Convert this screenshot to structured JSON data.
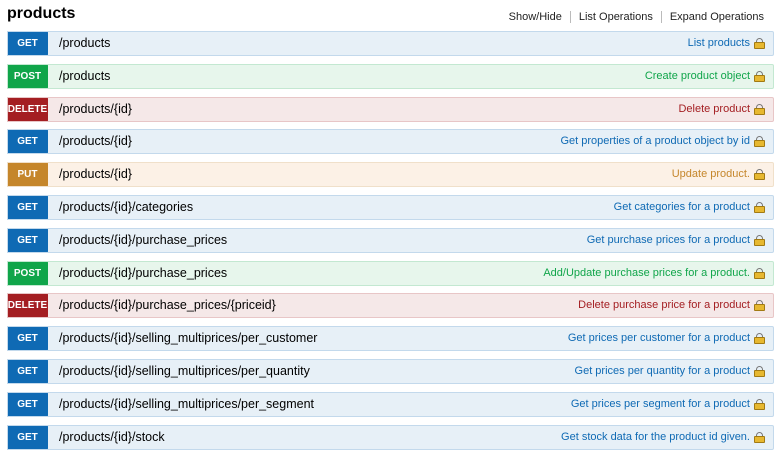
{
  "section": {
    "title": "products",
    "links": [
      "Show/Hide",
      "List Operations",
      "Expand Operations"
    ]
  },
  "operations": [
    {
      "method": "GET",
      "path": "/products",
      "summary": "List products"
    },
    {
      "method": "POST",
      "path": "/products",
      "summary": "Create product object"
    },
    {
      "method": "DELETE",
      "path": "/products/{id}",
      "summary": "Delete product"
    },
    {
      "method": "GET",
      "path": "/products/{id}",
      "summary": "Get properties of a product object by id"
    },
    {
      "method": "PUT",
      "path": "/products/{id}",
      "summary": "Update product."
    },
    {
      "method": "GET",
      "path": "/products/{id}/categories",
      "summary": "Get categories for a product"
    },
    {
      "method": "GET",
      "path": "/products/{id}/purchase_prices",
      "summary": "Get purchase prices for a product"
    },
    {
      "method": "POST",
      "path": "/products/{id}/purchase_prices",
      "summary": "Add/Update purchase prices for a product."
    },
    {
      "method": "DELETE",
      "path": "/products/{id}/purchase_prices/{priceid}",
      "summary": "Delete purchase price for a product"
    },
    {
      "method": "GET",
      "path": "/products/{id}/selling_multiprices/per_customer",
      "summary": "Get prices per customer for a product"
    },
    {
      "method": "GET",
      "path": "/products/{id}/selling_multiprices/per_quantity",
      "summary": "Get prices per quantity for a product"
    },
    {
      "method": "GET",
      "path": "/products/{id}/selling_multiprices/per_segment",
      "summary": "Get prices per segment for a product"
    },
    {
      "method": "GET",
      "path": "/products/{id}/stock",
      "summary": "Get stock data for the product id given."
    }
  ],
  "colors": {
    "GET": "#0f6ab4",
    "POST": "#10a54a",
    "DELETE": "#a41e22",
    "PUT": "#c5862b"
  },
  "icons": {
    "operation_auth": "lock-icon"
  }
}
